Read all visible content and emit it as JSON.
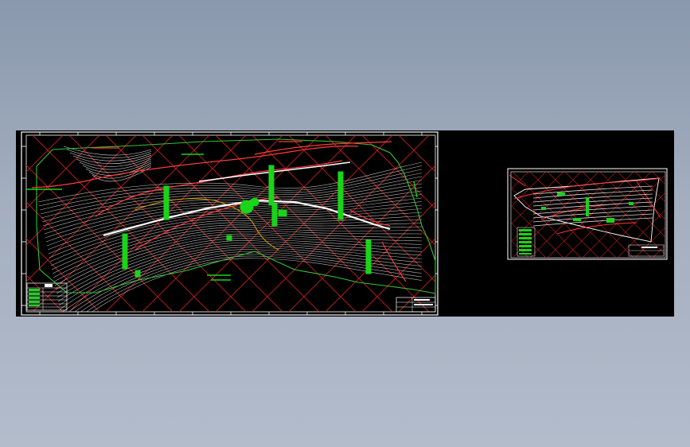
{
  "viewport": {
    "background": "#000000",
    "colors": {
      "grid": "#c81e1e",
      "border": "#ffffff",
      "contour": "#d8d8d8",
      "boundary": "#35c435",
      "road": "#ff3a3a",
      "annotation": "#19d419",
      "yellow": "#d6d600"
    }
  },
  "main_sheet": {
    "legend_title": "",
    "legend_rows": [
      "",
      "",
      "",
      "",
      "",
      ""
    ],
    "title_block": [
      "",
      "",
      "",
      ""
    ]
  },
  "thumbnail_sheet": {
    "legend_rows": [
      "",
      "",
      "",
      "",
      "",
      "",
      "",
      ""
    ],
    "title_block": [
      "",
      ""
    ]
  }
}
